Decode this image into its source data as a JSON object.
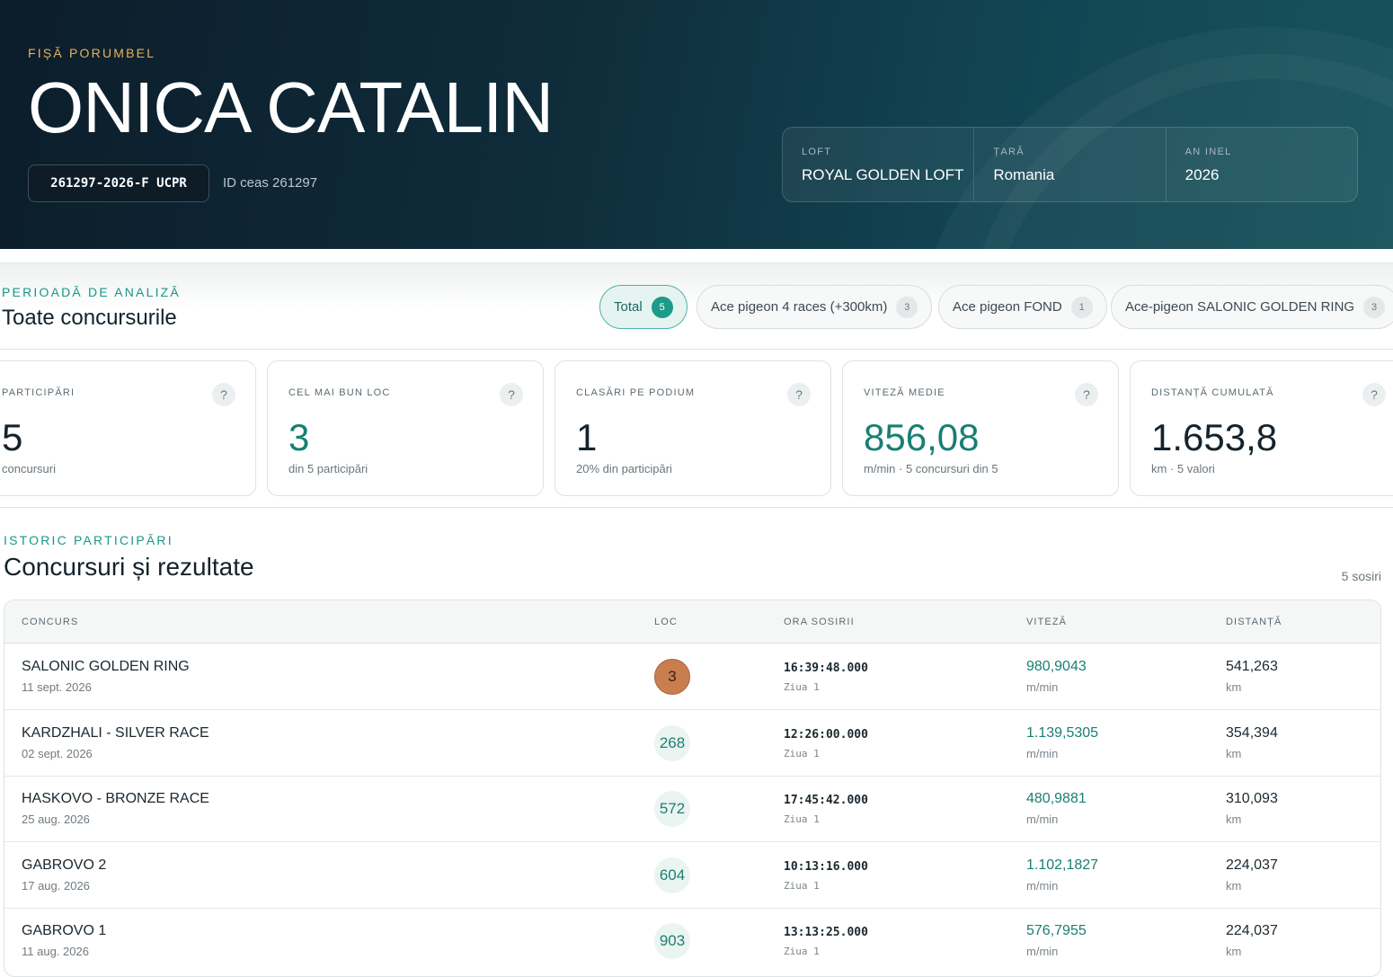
{
  "hero": {
    "eyebrow": "FIȘĂ PORUMBEL",
    "title": "ONICA CATALIN",
    "ring": "261297-2026-F UCPR",
    "clock_id": "ID ceas 261297",
    "info": [
      {
        "label": "LOFT",
        "value": "ROYAL GOLDEN LOFT"
      },
      {
        "label": "ȚARĂ",
        "value": "Romania"
      },
      {
        "label": "AN INEL",
        "value": "2026"
      }
    ]
  },
  "period": {
    "eyebrow": "PERIOADĂ DE ANALIZĂ",
    "title": "Toate concursurile",
    "filters": [
      {
        "label": "Total",
        "count": "5"
      },
      {
        "label": "Ace pigeon 4 races (+300km)",
        "count": "3"
      },
      {
        "label": "Ace pigeon FOND",
        "count": "1"
      },
      {
        "label": "Ace-pigeon SALONIC GOLDEN RING",
        "count": "3"
      }
    ]
  },
  "stats": [
    {
      "label": "PARTICIPĂRI",
      "value": "5",
      "sub": "concursuri"
    },
    {
      "label": "CEL MAI BUN LOC",
      "value": "3",
      "sub": "din 5 participări"
    },
    {
      "label": "CLASĂRI PE PODIUM",
      "value": "1",
      "sub": "20% din participări"
    },
    {
      "label": "VITEZĂ MEDIE",
      "value": "856,08",
      "sub": "m/min · 5 concursuri din 5"
    },
    {
      "label": "DISTANȚĂ CUMULATĂ",
      "value": "1.653,8",
      "sub": "km · 5 valori"
    }
  ],
  "help_icon": "?",
  "history": {
    "eyebrow": "ISTORIC PARTICIPĂRI",
    "title": "Concursuri și rezultate",
    "arrivals": "5 sosiri",
    "columns": [
      "CONCURS",
      "LOC",
      "ORA SOSIRII",
      "VITEZĂ",
      "DISTANȚĂ"
    ],
    "rows": [
      {
        "name": "SALONIC GOLDEN RING",
        "date": "11 sept. 2026",
        "place": "3",
        "time": "16:39:48.000",
        "day": "Ziua 1",
        "speed": "980,9043",
        "speed_unit": "m/min",
        "distance": "541,263",
        "distance_unit": "km"
      },
      {
        "name": "KARDZHALI - SILVER RACE",
        "date": "02 sept. 2026",
        "place": "268",
        "time": "12:26:00.000",
        "day": "Ziua 1",
        "speed": "1.139,5305",
        "speed_unit": "m/min",
        "distance": "354,394",
        "distance_unit": "km"
      },
      {
        "name": "HASKOVO - BRONZE RACE",
        "date": "25 aug. 2026",
        "place": "572",
        "time": "17:45:42.000",
        "day": "Ziua 1",
        "speed": "480,9881",
        "speed_unit": "m/min",
        "distance": "310,093",
        "distance_unit": "km"
      },
      {
        "name": "GABROVO 2",
        "date": "17 aug. 2026",
        "place": "604",
        "time": "10:13:16.000",
        "day": "Ziua 1",
        "speed": "1.102,1827",
        "speed_unit": "m/min",
        "distance": "224,037",
        "distance_unit": "km"
      },
      {
        "name": "GABROVO 1",
        "date": "11 aug. 2026",
        "place": "903",
        "time": "13:13:25.000",
        "day": "Ziua 1",
        "speed": "576,7955",
        "speed_unit": "m/min",
        "distance": "224,037",
        "distance_unit": "km"
      }
    ]
  },
  "colors": {
    "accent": "#1d9a8a",
    "gold": "#e8b35a",
    "bronze": "#c97e4f",
    "hero_dark": "#0c1d2b"
  }
}
